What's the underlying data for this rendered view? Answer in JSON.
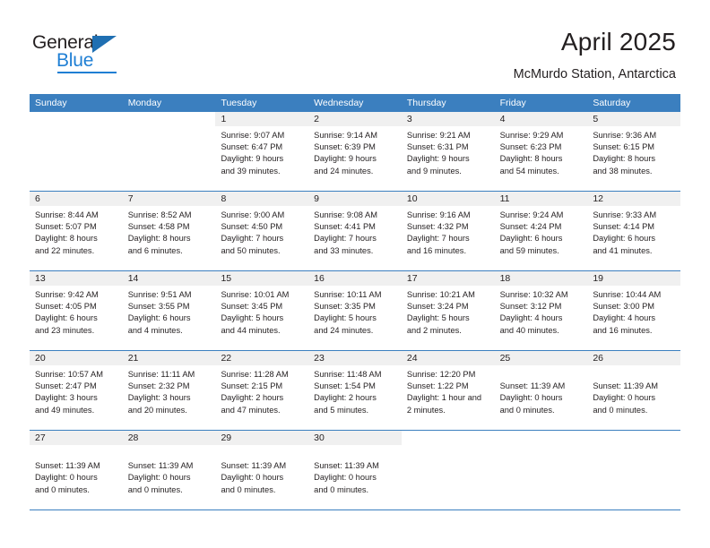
{
  "brand": {
    "name_part1": "General",
    "name_part2": "Blue",
    "triangle_icon": "blue-triangle-icon"
  },
  "header": {
    "title": "April 2025",
    "subtitle": "McMurdo Station, Antarctica"
  },
  "colors": {
    "header_blue": "#3b7fbf",
    "logo_blue": "#1f7fd4",
    "cell_band": "#f0f0f0",
    "text": "#231f20"
  },
  "weekdays": [
    "Sunday",
    "Monday",
    "Tuesday",
    "Wednesday",
    "Thursday",
    "Friday",
    "Saturday"
  ],
  "weeks": [
    [
      {
        "day": "",
        "blank": true,
        "lines": []
      },
      {
        "day": "",
        "blank": true,
        "lines": []
      },
      {
        "day": "1",
        "lines": [
          "Sunrise: 9:07 AM",
          "Sunset: 6:47 PM",
          "Daylight: 9 hours",
          "and 39 minutes."
        ]
      },
      {
        "day": "2",
        "lines": [
          "Sunrise: 9:14 AM",
          "Sunset: 6:39 PM",
          "Daylight: 9 hours",
          "and 24 minutes."
        ]
      },
      {
        "day": "3",
        "lines": [
          "Sunrise: 9:21 AM",
          "Sunset: 6:31 PM",
          "Daylight: 9 hours",
          "and 9 minutes."
        ]
      },
      {
        "day": "4",
        "lines": [
          "Sunrise: 9:29 AM",
          "Sunset: 6:23 PM",
          "Daylight: 8 hours",
          "and 54 minutes."
        ]
      },
      {
        "day": "5",
        "lines": [
          "Sunrise: 9:36 AM",
          "Sunset: 6:15 PM",
          "Daylight: 8 hours",
          "and 38 minutes."
        ]
      }
    ],
    [
      {
        "day": "6",
        "lines": [
          "Sunrise: 8:44 AM",
          "Sunset: 5:07 PM",
          "Daylight: 8 hours",
          "and 22 minutes."
        ]
      },
      {
        "day": "7",
        "lines": [
          "Sunrise: 8:52 AM",
          "Sunset: 4:58 PM",
          "Daylight: 8 hours",
          "and 6 minutes."
        ]
      },
      {
        "day": "8",
        "lines": [
          "Sunrise: 9:00 AM",
          "Sunset: 4:50 PM",
          "Daylight: 7 hours",
          "and 50 minutes."
        ]
      },
      {
        "day": "9",
        "lines": [
          "Sunrise: 9:08 AM",
          "Sunset: 4:41 PM",
          "Daylight: 7 hours",
          "and 33 minutes."
        ]
      },
      {
        "day": "10",
        "lines": [
          "Sunrise: 9:16 AM",
          "Sunset: 4:32 PM",
          "Daylight: 7 hours",
          "and 16 minutes."
        ]
      },
      {
        "day": "11",
        "lines": [
          "Sunrise: 9:24 AM",
          "Sunset: 4:24 PM",
          "Daylight: 6 hours",
          "and 59 minutes."
        ]
      },
      {
        "day": "12",
        "lines": [
          "Sunrise: 9:33 AM",
          "Sunset: 4:14 PM",
          "Daylight: 6 hours",
          "and 41 minutes."
        ]
      }
    ],
    [
      {
        "day": "13",
        "lines": [
          "Sunrise: 9:42 AM",
          "Sunset: 4:05 PM",
          "Daylight: 6 hours",
          "and 23 minutes."
        ]
      },
      {
        "day": "14",
        "lines": [
          "Sunrise: 9:51 AM",
          "Sunset: 3:55 PM",
          "Daylight: 6 hours",
          "and 4 minutes."
        ]
      },
      {
        "day": "15",
        "lines": [
          "Sunrise: 10:01 AM",
          "Sunset: 3:45 PM",
          "Daylight: 5 hours",
          "and 44 minutes."
        ]
      },
      {
        "day": "16",
        "lines": [
          "Sunrise: 10:11 AM",
          "Sunset: 3:35 PM",
          "Daylight: 5 hours",
          "and 24 minutes."
        ]
      },
      {
        "day": "17",
        "lines": [
          "Sunrise: 10:21 AM",
          "Sunset: 3:24 PM",
          "Daylight: 5 hours",
          "and 2 minutes."
        ]
      },
      {
        "day": "18",
        "lines": [
          "Sunrise: 10:32 AM",
          "Sunset: 3:12 PM",
          "Daylight: 4 hours",
          "and 40 minutes."
        ]
      },
      {
        "day": "19",
        "lines": [
          "Sunrise: 10:44 AM",
          "Sunset: 3:00 PM",
          "Daylight: 4 hours",
          "and 16 minutes."
        ]
      }
    ],
    [
      {
        "day": "20",
        "lines": [
          "Sunrise: 10:57 AM",
          "Sunset: 2:47 PM",
          "Daylight: 3 hours",
          "and 49 minutes."
        ]
      },
      {
        "day": "21",
        "lines": [
          "Sunrise: 11:11 AM",
          "Sunset: 2:32 PM",
          "Daylight: 3 hours",
          "and 20 minutes."
        ]
      },
      {
        "day": "22",
        "lines": [
          "Sunrise: 11:28 AM",
          "Sunset: 2:15 PM",
          "Daylight: 2 hours",
          "and 47 minutes."
        ]
      },
      {
        "day": "23",
        "lines": [
          "Sunrise: 11:48 AM",
          "Sunset: 1:54 PM",
          "Daylight: 2 hours",
          "and 5 minutes."
        ]
      },
      {
        "day": "24",
        "lines": [
          "Sunrise: 12:20 PM",
          "Sunset: 1:22 PM",
          "Daylight: 1 hour and",
          "2 minutes."
        ]
      },
      {
        "day": "25",
        "lines": [
          "",
          "Sunset: 11:39 AM",
          "Daylight: 0 hours",
          "and 0 minutes."
        ]
      },
      {
        "day": "26",
        "lines": [
          "",
          "Sunset: 11:39 AM",
          "Daylight: 0 hours",
          "and 0 minutes."
        ]
      }
    ],
    [
      {
        "day": "27",
        "lines": [
          "",
          "Sunset: 11:39 AM",
          "Daylight: 0 hours",
          "and 0 minutes."
        ]
      },
      {
        "day": "28",
        "lines": [
          "",
          "Sunset: 11:39 AM",
          "Daylight: 0 hours",
          "and 0 minutes."
        ]
      },
      {
        "day": "29",
        "lines": [
          "",
          "Sunset: 11:39 AM",
          "Daylight: 0 hours",
          "and 0 minutes."
        ]
      },
      {
        "day": "30",
        "lines": [
          "",
          "Sunset: 11:39 AM",
          "Daylight: 0 hours",
          "and 0 minutes."
        ]
      },
      {
        "day": "",
        "blank": true,
        "lines": []
      },
      {
        "day": "",
        "blank": true,
        "lines": []
      },
      {
        "day": "",
        "blank": true,
        "lines": []
      }
    ]
  ]
}
